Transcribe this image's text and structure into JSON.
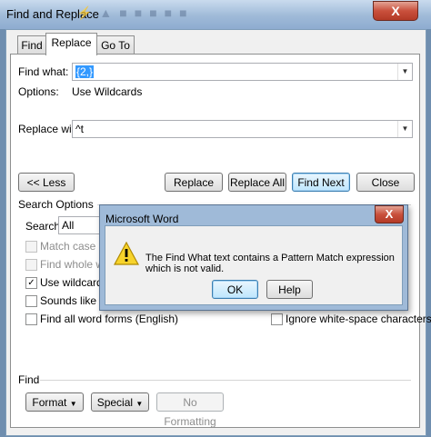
{
  "window": {
    "title": "Find and Replace",
    "close_glyph": "X"
  },
  "tabs": [
    {
      "label": "Find",
      "active": false
    },
    {
      "label": "Replace",
      "active": true
    },
    {
      "label": "Go To",
      "active": false
    }
  ],
  "find": {
    "label": "Find what:",
    "value": "{2,}",
    "options_label": "Options:",
    "options_value": "Use Wildcards"
  },
  "replace": {
    "label": "Replace with:",
    "value": "^t"
  },
  "buttons": {
    "less": "<< Less",
    "replace": "Replace",
    "replace_all": "Replace All",
    "find_next": "Find Next",
    "close": "Close"
  },
  "search_options": {
    "header": "Search Options",
    "search_label": "Search:",
    "search_value": "All",
    "checkboxes": [
      {
        "label": "Match case",
        "checked": false,
        "disabled": true
      },
      {
        "label": "Find whole words",
        "checked": false,
        "disabled": true
      },
      {
        "label": "Use wildcards",
        "checked": true,
        "disabled": false
      },
      {
        "label": "Sounds like (English)",
        "checked": false,
        "disabled": false
      },
      {
        "label": "Find all word forms (English)",
        "checked": false,
        "disabled": false
      }
    ],
    "right_checkbox": {
      "label": "Ignore white-space characters",
      "checked": false
    }
  },
  "find_section": {
    "header": "Find",
    "format": "Format",
    "special": "Special",
    "no_formatting": "No Formatting"
  },
  "dialog": {
    "title": "Microsoft Word",
    "close_glyph": "X",
    "message": "The Find What text contains a Pattern Match expression which is not valid.",
    "ok": "OK",
    "help": "Help",
    "icon": "warning-icon"
  }
}
